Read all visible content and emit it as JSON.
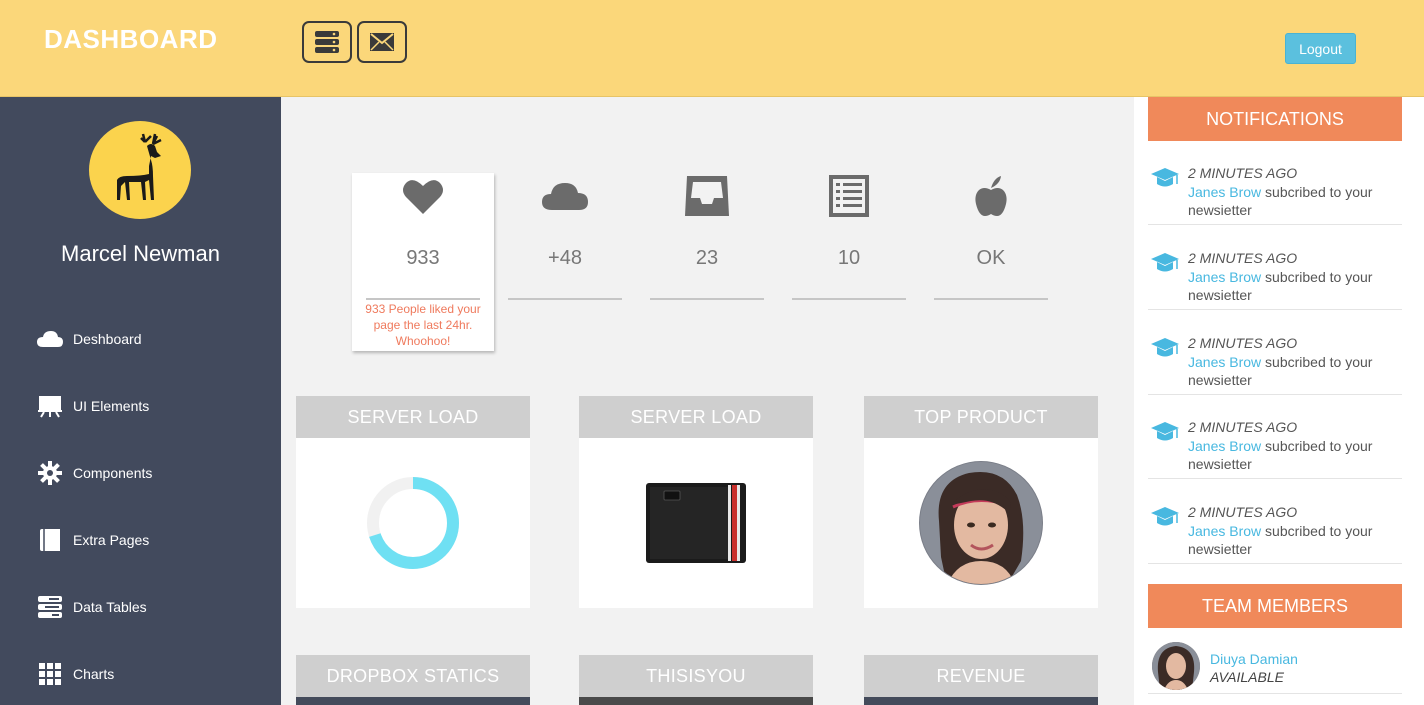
{
  "header": {
    "brand": "DASHBOARD",
    "menu_icon": "server-icon",
    "mail_icon": "envelope-icon",
    "logout_label": "Logout"
  },
  "sidebar": {
    "avatar_icon": "deer-icon",
    "user_name": "Marcel Newman",
    "items": [
      {
        "label": "Deshboard",
        "icon": "cloud-icon"
      },
      {
        "label": "UI Elements",
        "icon": "desktop-icon"
      },
      {
        "label": "Components",
        "icon": "gear-icon"
      },
      {
        "label": "Extra Pages",
        "icon": "book-icon"
      },
      {
        "label": "Data Tables",
        "icon": "tasks-icon"
      },
      {
        "label": "Charts",
        "icon": "grid-icon"
      }
    ]
  },
  "stats": [
    {
      "value": "933",
      "icon": "heart-icon",
      "tip": "933 People liked your page the last 24hr. Whoohoo!"
    },
    {
      "value": "+48",
      "icon": "cloud-icon"
    },
    {
      "value": "23",
      "icon": "inbox-icon"
    },
    {
      "value": "10",
      "icon": "list-icon"
    },
    {
      "value": "OK",
      "icon": "apple-icon"
    }
  ],
  "panels": [
    {
      "title": "SERVER LOAD",
      "content": "donut-chart",
      "load_fraction": 0.7
    },
    {
      "title": "SERVER LOAD",
      "content": "wallet-image"
    },
    {
      "title": "TOP PRODUCT",
      "content": "portrait-image"
    },
    {
      "title": "DROPBOX STATICS"
    },
    {
      "title": "THISISYOU"
    },
    {
      "title": "REVENUE"
    }
  ],
  "notifications": {
    "title": "NOTIFICATIONS",
    "items": [
      {
        "time": "2 MINUTES AGO",
        "who": "Janes Brow",
        "text": " subcribed to your newsietter"
      },
      {
        "time": "2 MINUTES AGO",
        "who": "Janes Brow",
        "text": " subcribed to your newsietter"
      },
      {
        "time": "2 MINUTES AGO",
        "who": "Janes Brow",
        "text": " subcribed to your newsietter"
      },
      {
        "time": "2 MINUTES AGO",
        "who": "Janes Brow",
        "text": " subcribed to your newsietter"
      },
      {
        "time": "2 MINUTES AGO",
        "who": "Janes Brow",
        "text": " subcribed to your newsietter"
      }
    ]
  },
  "team": {
    "title": "TEAM MEMBERS",
    "members": [
      {
        "name": "Diuya Damian",
        "status": "AVAILABLE"
      }
    ]
  },
  "colors": {
    "header": "#fbd77a",
    "sidebar": "#424a5d",
    "accent_orange": "#f0895a",
    "accent_blue": "#48b8e0",
    "donut": "#6fe0f3"
  }
}
